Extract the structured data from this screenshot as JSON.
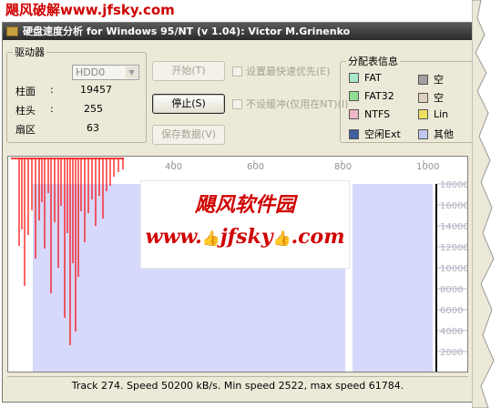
{
  "watermark": {
    "text": "飓风破解www.jfsky.com"
  },
  "window": {
    "title": "硬盘速度分析 for Windows 95/NT (v 1.04): Victor M.Grinenko"
  },
  "drive": {
    "group_label": "驱动器",
    "selected": "HDD0",
    "fields": [
      {
        "label": "柱面",
        "sep": ":",
        "value": "19457"
      },
      {
        "label": "柱头",
        "sep": ":",
        "value": "255"
      },
      {
        "label": "扇区",
        "sep": ":",
        "value": "63"
      }
    ]
  },
  "buttons": {
    "start": "开始(T)",
    "stop": "停止(S)",
    "save": "保存数据(V)"
  },
  "options": {
    "priority": "设置最快速优先(E)",
    "no_buffer": "不设缓冲(仅用在NT)(I)"
  },
  "partition": {
    "group_label": "分配表信息",
    "items": [
      {
        "label": "FAT",
        "color": "#a8e8c8"
      },
      {
        "label": "空",
        "color": "#a0a0a0"
      },
      {
        "label": "FAT32",
        "color": "#90e090"
      },
      {
        "label": "空",
        "color": "#e0d0c0"
      },
      {
        "label": "NTFS",
        "color": "#f0b8c8"
      },
      {
        "label": "Lin",
        "color": "#f0e060"
      },
      {
        "label": "空闲Ext",
        "color": "#4060a0"
      },
      {
        "label": "其他",
        "color": "#c0c8f0"
      }
    ]
  },
  "chart_data": {
    "type": "line",
    "x_ticks": [
      "400",
      "600",
      "800",
      "1000"
    ],
    "y_ticks": [
      "18000",
      "16000",
      "14000",
      "12000",
      "10000",
      "8000",
      "6000",
      "4000",
      "2000"
    ],
    "bands": [
      {
        "x0": 27,
        "x1": 370,
        "color": "#d6d8fc"
      },
      {
        "x0": 378,
        "x1": 466,
        "color": "#d6d8fc"
      }
    ],
    "progress_track": 274,
    "cursor_x": 470,
    "speed_line_color": "#ff0000",
    "speed_drop_lines": [
      {
        "x": 12,
        "bottom": 96
      },
      {
        "x": 15,
        "bottom": 78
      },
      {
        "x": 18,
        "bottom": 140
      },
      {
        "x": 22,
        "bottom": 84
      },
      {
        "x": 26,
        "bottom": 57
      },
      {
        "x": 30,
        "bottom": 110
      },
      {
        "x": 34,
        "bottom": 68
      },
      {
        "x": 37,
        "bottom": 48
      },
      {
        "x": 40,
        "bottom": 99
      },
      {
        "x": 44,
        "bottom": 38
      },
      {
        "x": 47,
        "bottom": 148
      },
      {
        "x": 51,
        "bottom": 70
      },
      {
        "x": 55,
        "bottom": 120
      },
      {
        "x": 58,
        "bottom": 52
      },
      {
        "x": 62,
        "bottom": 175
      },
      {
        "x": 65,
        "bottom": 82
      },
      {
        "x": 68,
        "bottom": 205
      },
      {
        "x": 71,
        "bottom": 115
      },
      {
        "x": 74,
        "bottom": 190
      },
      {
        "x": 77,
        "bottom": 130
      },
      {
        "x": 80,
        "bottom": 58
      },
      {
        "x": 84,
        "bottom": 92
      },
      {
        "x": 88,
        "bottom": 60
      },
      {
        "x": 92,
        "bottom": 45
      },
      {
        "x": 96,
        "bottom": 74
      },
      {
        "x": 100,
        "bottom": 41
      },
      {
        "x": 104,
        "bottom": 66
      },
      {
        "x": 108,
        "bottom": 36
      },
      {
        "x": 112,
        "bottom": 30
      },
      {
        "x": 116,
        "bottom": 20
      },
      {
        "x": 121,
        "bottom": 15
      },
      {
        "x": 126,
        "bottom": 12
      }
    ],
    "speed_top_range": [
      3,
      127
    ]
  },
  "ad": {
    "line1": "飓风软件园",
    "line2_prefix": "www.",
    "line2_mid": "jfsky",
    "line2_suffix": ".com"
  },
  "status": {
    "text": "Track 274. Speed 50200 kB/s. Min speed 2522, max speed 61784."
  }
}
